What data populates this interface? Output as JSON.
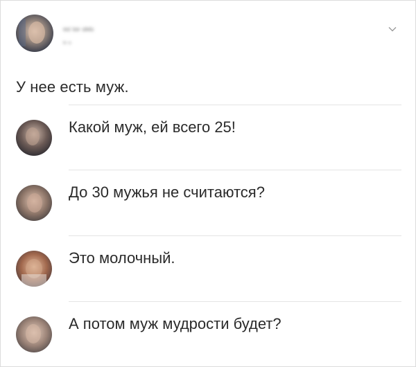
{
  "post": {
    "author_name": "ᵥᵤᵢ ᵢᵤᵥ ᵤᵢᵥᵢᵤ",
    "date": "ᵢᵥ ᵤ",
    "text": "У нее есть муж."
  },
  "comments": [
    {
      "text": "Какой муж, ей всего 25!",
      "avatar_color": "#6b5a55"
    },
    {
      "text": "До 30 мужья не считаются?",
      "avatar_color": "#8d7568"
    },
    {
      "text": "Это молочный.",
      "avatar_color": "#a0674c"
    },
    {
      "text": "А потом муж мудрости будет?",
      "avatar_color": "#9c8478"
    }
  ],
  "colors": {
    "text": "#2a2a2a",
    "divider": "#e4e4e4",
    "border": "#dcdcdc"
  },
  "icons": {
    "menu": "chevron-down-icon"
  }
}
